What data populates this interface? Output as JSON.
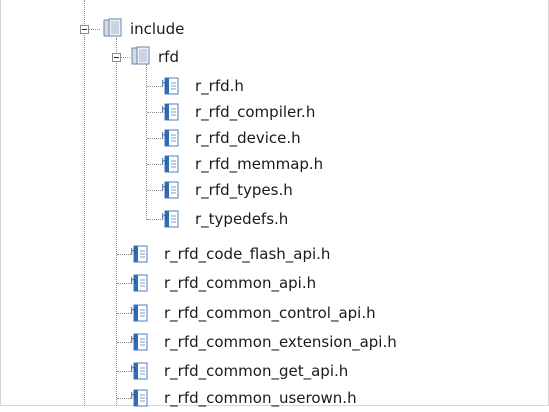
{
  "tree": {
    "include": {
      "label": "include",
      "icon": "folder-open-icon",
      "expanded": true,
      "rfd": {
        "label": "rfd",
        "icon": "folder-open-icon",
        "expanded": true,
        "files": [
          {
            "label": "r_rfd.h",
            "icon": "header-file-icon"
          },
          {
            "label": "r_rfd_compiler.h",
            "icon": "header-file-icon"
          },
          {
            "label": "r_rfd_device.h",
            "icon": "header-file-icon"
          },
          {
            "label": "r_rfd_memmap.h",
            "icon": "header-file-icon"
          },
          {
            "label": "r_rfd_types.h",
            "icon": "header-file-icon"
          },
          {
            "label": "r_typedefs.h",
            "icon": "header-file-icon"
          }
        ]
      },
      "files": [
        {
          "label": "r_rfd_code_flash_api.h",
          "icon": "header-file-icon"
        },
        {
          "label": "r_rfd_common_api.h",
          "icon": "header-file-icon"
        },
        {
          "label": "r_rfd_common_control_api.h",
          "icon": "header-file-icon"
        },
        {
          "label": "r_rfd_common_extension_api.h",
          "icon": "header-file-icon"
        },
        {
          "label": "r_rfd_common_get_api.h",
          "icon": "header-file-icon"
        },
        {
          "label": "r_rfd_common_userown.h",
          "icon": "header-file-icon"
        }
      ]
    }
  },
  "colors": {
    "folder_light": "#e3e8ef",
    "folder_dark": "#3a6fa8",
    "file_blue": "#2e6db4",
    "tree_line": "#8f8f8f",
    "border": "#d6d6d6"
  }
}
